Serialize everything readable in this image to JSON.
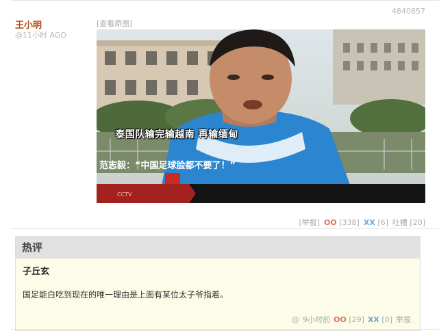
{
  "post": {
    "id": "4840857",
    "author": "王小明",
    "time_ago": "@11小时 AGO",
    "view_original": "[查看原图]",
    "image": {
      "subtitle_line1": "泰国队输完输越南 再输缅甸",
      "subtitle_line2": "范志毅：“中国足球脸都不要了！”"
    },
    "actions": {
      "report": "[举报]",
      "oo_label": "OO",
      "oo_count": "[338]",
      "xx_label": "XX",
      "xx_count": "[6]",
      "comments": "吐槽 [20]"
    }
  },
  "hot_comments": {
    "title": "热评",
    "items": [
      {
        "author": "子丘玄",
        "text": "国足能白吃到现在的唯一理由是上面有某位太子爷指着。",
        "at": "@",
        "time": "9小时前",
        "oo_label": "OO",
        "oo_count": "[29]",
        "xx_label": "XX",
        "xx_count": "[0]",
        "report": "举报"
      }
    ]
  },
  "colors": {
    "author": "#b14a12",
    "oo": "#e2715a",
    "xx": "#6ea7d8",
    "hot_bg": "#fcfce8",
    "hot_header": "#e1e1e1"
  }
}
